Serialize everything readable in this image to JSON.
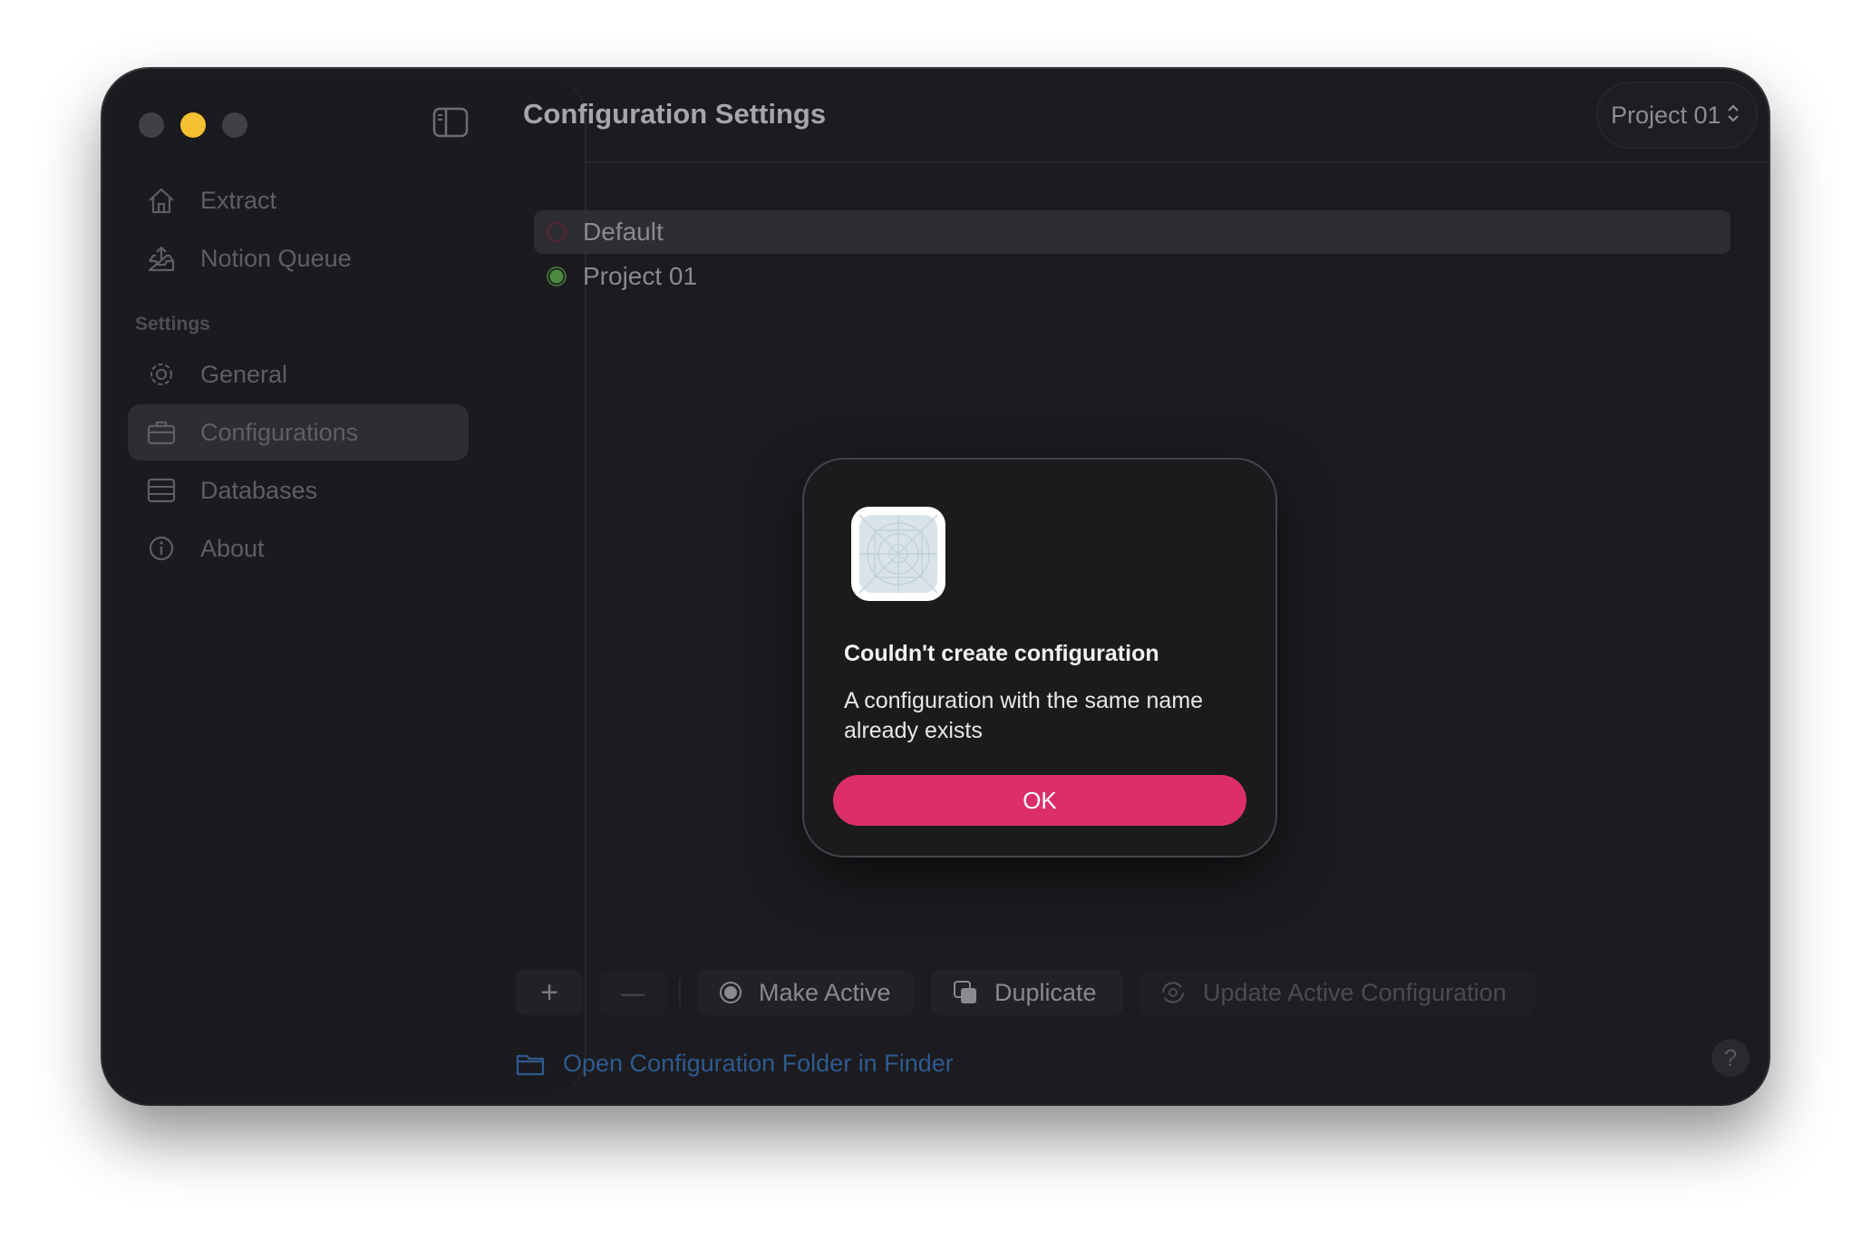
{
  "window": {
    "title": "Configuration Settings"
  },
  "sidebar": {
    "items": [
      {
        "label": "Extract",
        "icon": "house-icon"
      },
      {
        "label": "Notion Queue",
        "icon": "tray-upload-icon"
      }
    ],
    "section_label": "Settings",
    "settings_items": [
      {
        "label": "General",
        "icon": "gear-icon"
      },
      {
        "label": "Configurations",
        "icon": "briefcase-icon",
        "selected": true
      },
      {
        "label": "Databases",
        "icon": "database-icon"
      },
      {
        "label": "About",
        "icon": "info-icon"
      }
    ]
  },
  "header": {
    "project_picker": "Project 01"
  },
  "configurations": [
    {
      "name": "Default",
      "active": false,
      "selected": true
    },
    {
      "name": "Project 01",
      "active": true,
      "selected": false
    }
  ],
  "toolbar": {
    "add_label": "+",
    "remove_label": "—",
    "make_active": "Make Active",
    "duplicate": "Duplicate",
    "update_active": "Update Active Configuration"
  },
  "footer": {
    "open_folder": "Open Configuration Folder in Finder",
    "help": "?"
  },
  "dialog": {
    "title": "Couldn't create configuration",
    "message": "A configuration with the same name already exists",
    "ok": "OK"
  },
  "colors": {
    "accent": "#dc2f6a",
    "active_green": "#4c8a3f",
    "link": "#2e5a8f"
  }
}
